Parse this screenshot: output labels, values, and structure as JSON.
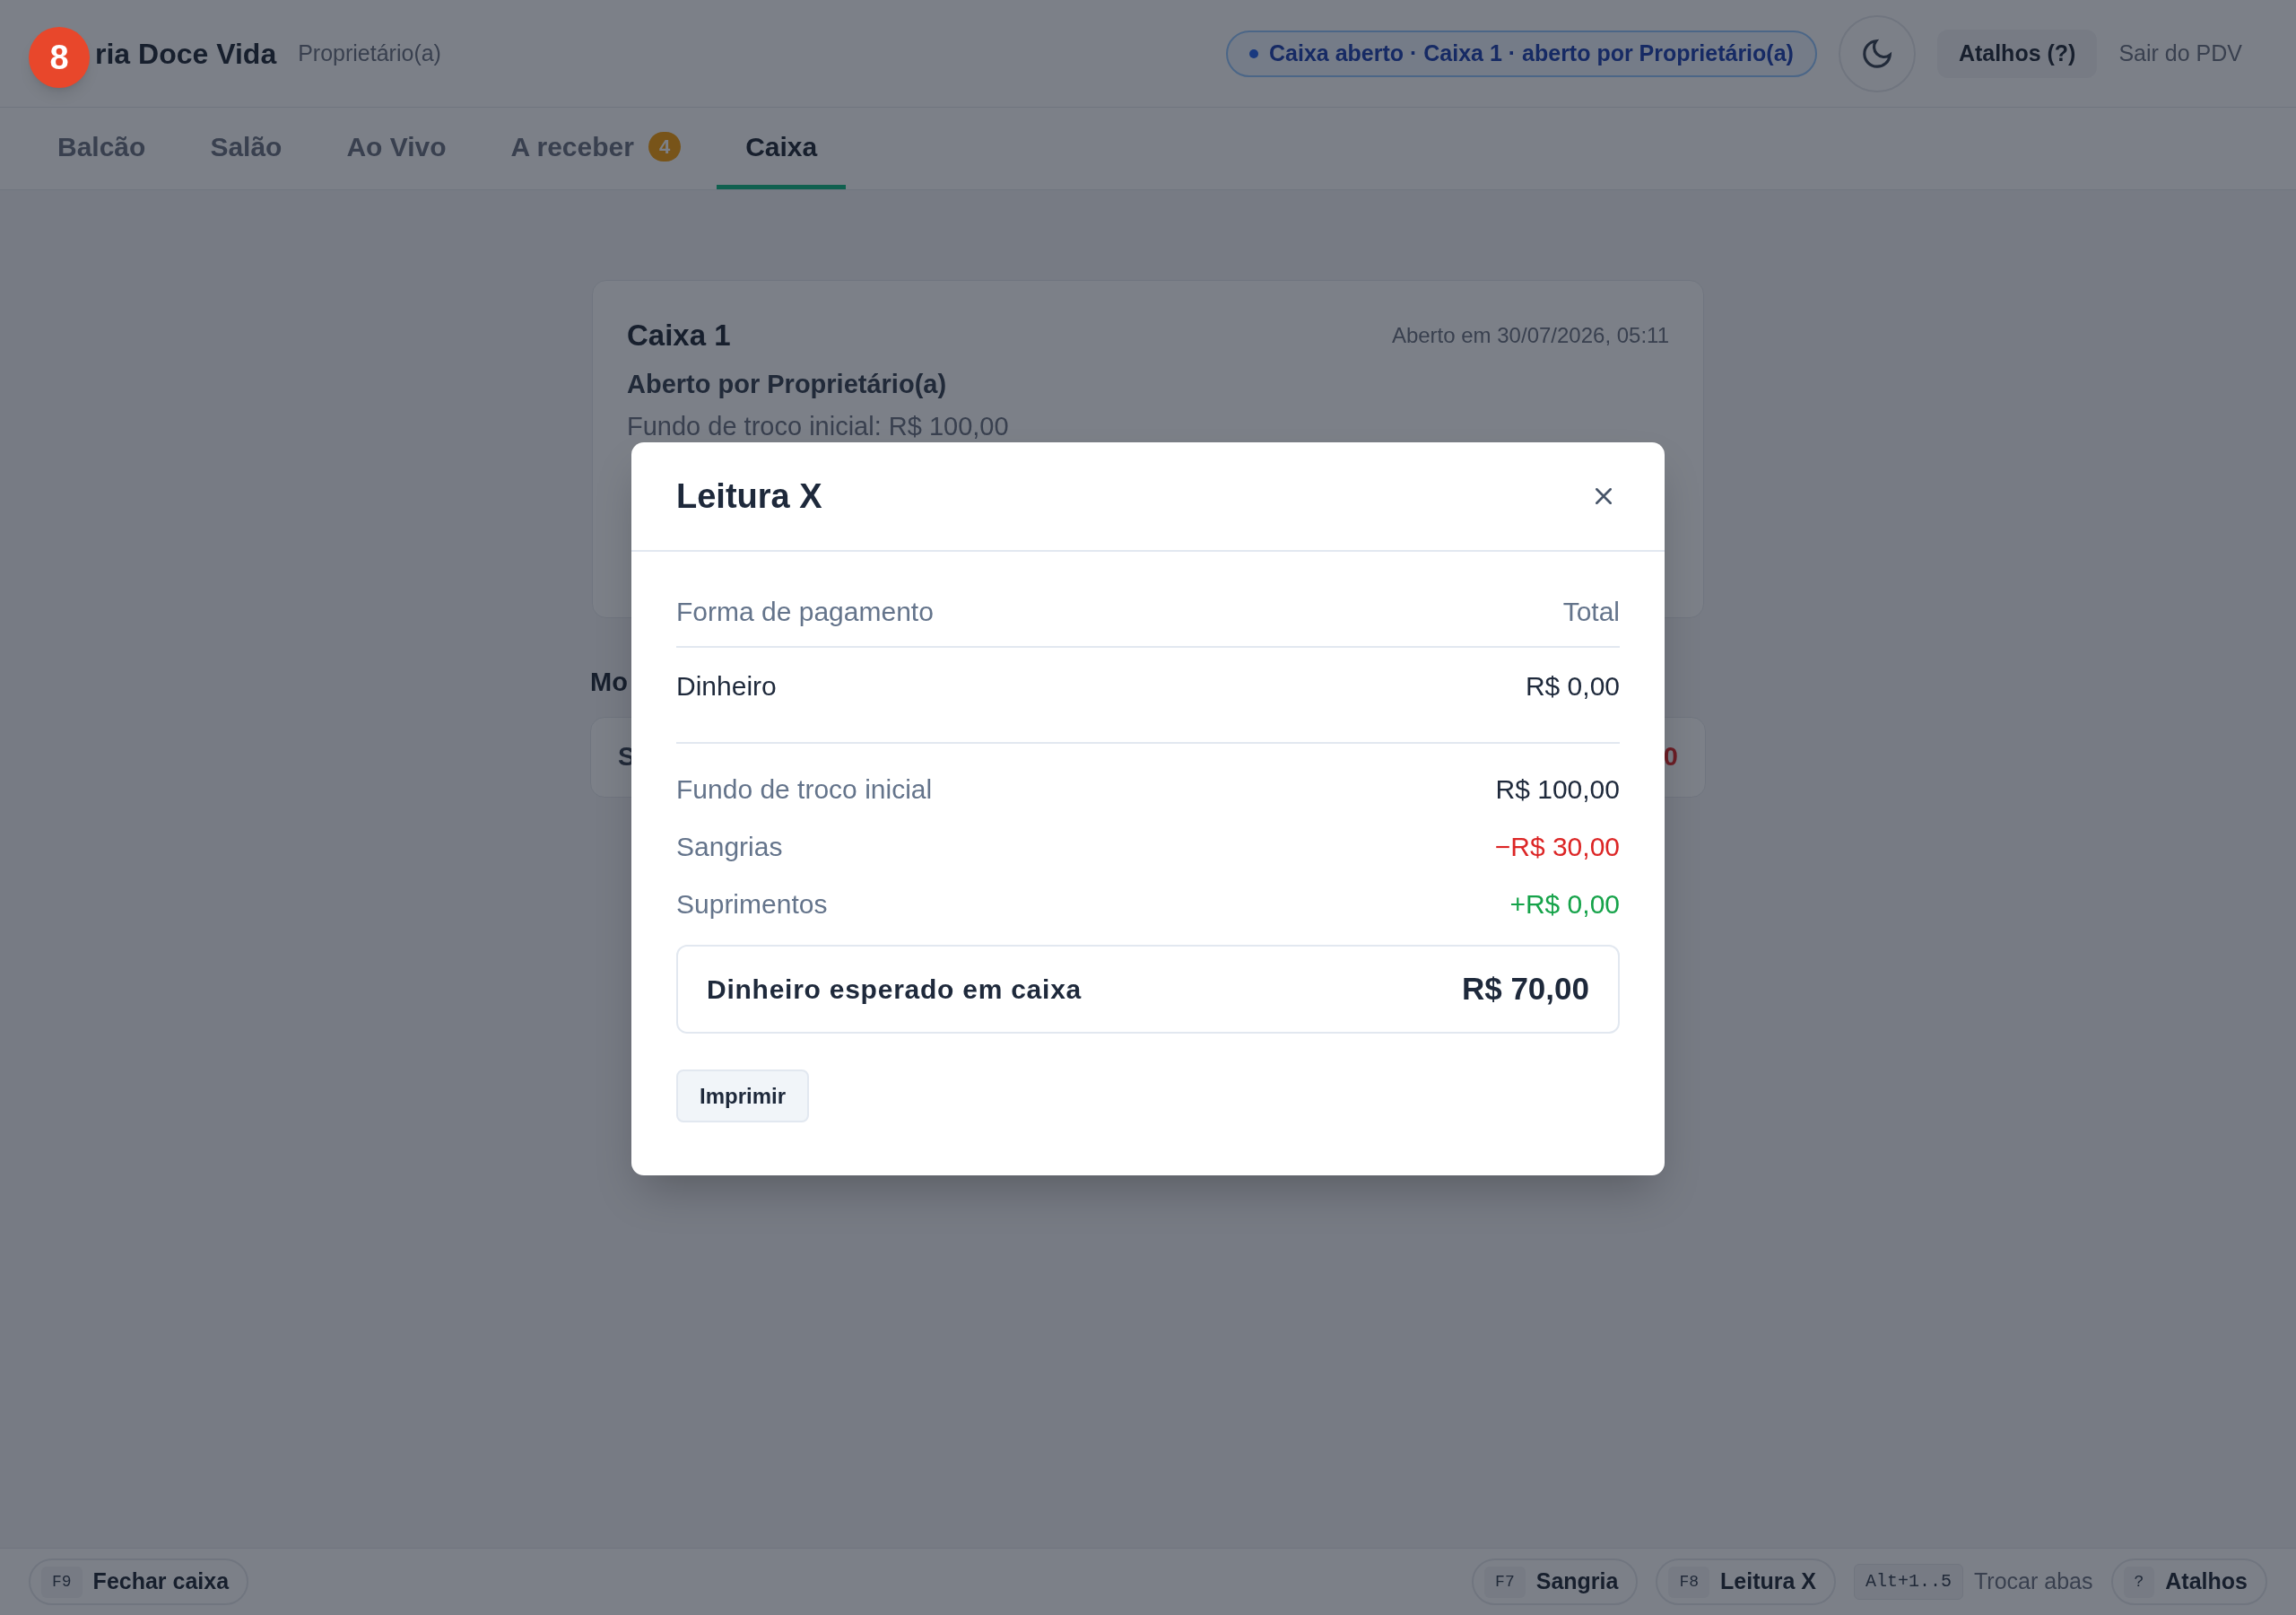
{
  "step_badge": "8",
  "header": {
    "brand": "ria Doce Vida",
    "role": "Proprietário(a)",
    "status": "Caixa aberto · Caixa 1 · aberto por Proprietário(a)",
    "shortcuts_button": "Atalhos (?)",
    "exit_link": "Sair do PDV"
  },
  "tabs": [
    {
      "label": "Balcão",
      "selected": false
    },
    {
      "label": "Salão",
      "selected": false
    },
    {
      "label": "Ao Vivo",
      "selected": false
    },
    {
      "label": "A receber",
      "badge": "4",
      "selected": false
    },
    {
      "label": "Caixa",
      "selected": true
    }
  ],
  "register_card": {
    "title": "Caixa 1",
    "opened_at": "Aberto em 30/07/2026, 05:11",
    "opened_by": "Aberto por Proprietário(a)",
    "initial_float": "Fundo de troco inicial: R$ 100,00"
  },
  "movements": {
    "heading": "Mo",
    "row_label": "S",
    "row_value": "0"
  },
  "modal": {
    "title": "Leitura X",
    "columns": [
      "Forma de pagamento",
      "Total"
    ],
    "rows": [
      {
        "method": "Dinheiro",
        "total": "R$ 0,00"
      }
    ],
    "summary": [
      {
        "label": "Fundo de troco inicial",
        "value": "R$ 100,00",
        "kind": "neutral"
      },
      {
        "label": "Sangrias",
        "value": "−R$ 30,00",
        "kind": "negative"
      },
      {
        "label": "Suprimentos",
        "value": "+R$ 0,00",
        "kind": "positive"
      }
    ],
    "expected": {
      "label": "Dinheiro esperado em caixa",
      "value": "R$ 70,00"
    },
    "print_button": "Imprimir"
  },
  "footer": {
    "left": [
      {
        "key": "F9",
        "label": "Fechar caixa",
        "kind": "action"
      }
    ],
    "right": [
      {
        "key": "F7",
        "label": "Sangria",
        "kind": "action"
      },
      {
        "key": "F8",
        "label": "Leitura X",
        "kind": "action"
      },
      {
        "key": "Alt+1..5",
        "label": "Trocar abas",
        "kind": "hint"
      },
      {
        "key": "?",
        "label": "Atalhos",
        "kind": "action"
      }
    ]
  }
}
